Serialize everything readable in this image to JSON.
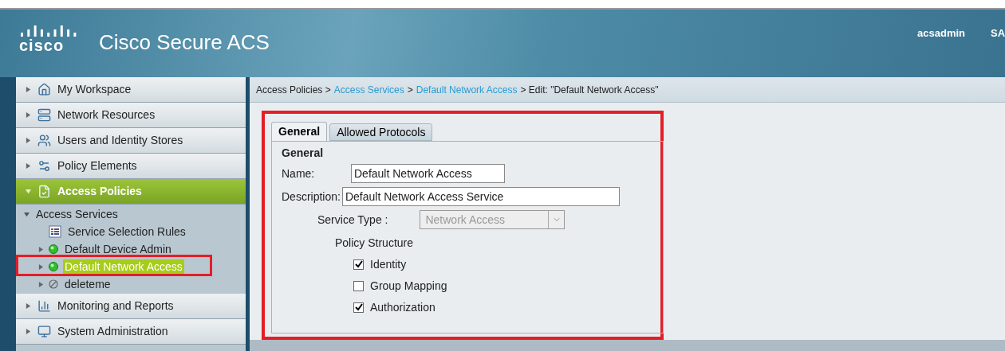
{
  "header": {
    "logo": "cisco",
    "title": "Cisco Secure ACS",
    "user": "acsadmin",
    "host": "SA"
  },
  "sidebar": {
    "items": [
      {
        "label": "My Workspace",
        "kind": "workspace",
        "selected": false,
        "expanded": false
      },
      {
        "label": "Network Resources",
        "kind": "network",
        "selected": false,
        "expanded": false
      },
      {
        "label": "Users and Identity Stores",
        "kind": "users",
        "selected": false,
        "expanded": false
      },
      {
        "label": "Policy Elements",
        "kind": "policy",
        "selected": false,
        "expanded": false
      },
      {
        "label": "Access Policies",
        "kind": "access",
        "selected": true,
        "expanded": true,
        "children": [
          {
            "label": "Access Services",
            "kind": "folder",
            "expanded": true,
            "selected": false,
            "children": [
              {
                "label": "Service Selection Rules",
                "kind": "rules",
                "selected": false
              },
              {
                "label": "Default Device Admin",
                "kind": "service",
                "enabled": true,
                "expanded": false,
                "selected": false
              },
              {
                "label": "Default Network Access",
                "kind": "service",
                "enabled": true,
                "expanded": false,
                "selected": true
              },
              {
                "label": "deleteme",
                "kind": "service",
                "enabled": false,
                "expanded": false,
                "selected": false
              }
            ]
          }
        ]
      },
      {
        "label": "Monitoring and Reports",
        "kind": "monitoring",
        "selected": false,
        "expanded": false
      },
      {
        "label": "System Administration",
        "kind": "system",
        "selected": false,
        "expanded": false
      }
    ]
  },
  "breadcrumb": [
    {
      "label": "Access Policies >",
      "link": false
    },
    {
      "label": "Access Services",
      "link": true
    },
    {
      "label": ">",
      "link": false
    },
    {
      "label": "Default Network Access",
      "link": true
    },
    {
      "label": "> Edit: \"Default Network Access\"",
      "link": false
    }
  ],
  "tabs": [
    {
      "label": "General",
      "selected": true
    },
    {
      "label": "Allowed Protocols",
      "selected": false
    }
  ],
  "form": {
    "heading": "General",
    "name": {
      "label": "Name:",
      "value": "Default Network Access"
    },
    "description": {
      "label": "Description:",
      "value": "Default Network Access Service"
    },
    "service_type": {
      "label": "Service Type :",
      "value": "Network Access",
      "disabled": true
    },
    "policy_structure": {
      "label": "Policy Structure",
      "options": [
        {
          "label": "Identity",
          "checked": true
        },
        {
          "label": "Group Mapping",
          "checked": false
        },
        {
          "label": "Authorization",
          "checked": true
        }
      ]
    }
  }
}
